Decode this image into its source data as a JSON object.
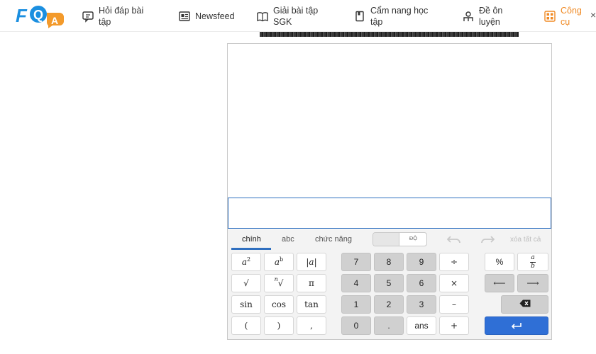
{
  "header": {
    "logo": {
      "letters": "FQA",
      "colors": {
        "blue": "#1b8fe0",
        "orange": "#f39a2b"
      }
    },
    "nav": [
      {
        "label_line1": "Hỏi đáp bài",
        "label_line2": "tập",
        "icon": "chat-question-icon"
      },
      {
        "label_line1": "Newsfeed",
        "label_line2": "",
        "icon": "newspaper-icon"
      },
      {
        "label_line1": "Giải bài tập",
        "label_line2": "SGK",
        "icon": "open-book-icon"
      },
      {
        "label_line1": "Cẩm nang học",
        "label_line2": "tập",
        "icon": "handbook-icon"
      },
      {
        "label_line1": "Đề ôn",
        "label_line2": "luyện",
        "icon": "student-icon"
      },
      {
        "label_line1": "Công",
        "label_line2": "cụ",
        "icon": "calculator-grid-icon",
        "active": true
      }
    ],
    "close_glyph": "×",
    "accent_color": "#f08a24"
  },
  "calculator": {
    "tabs": [
      {
        "label": "chính",
        "selected": true
      },
      {
        "label": "abc",
        "selected": false
      },
      {
        "label": "chức năng",
        "selected": false
      }
    ],
    "angle_toggle": {
      "right_label": "ĐỘ"
    },
    "clear_all": "xóa tất cả",
    "keys": {
      "a_squared": {
        "base": "a",
        "exp": "2"
      },
      "a_pow_b": {
        "base": "a",
        "exp": "b"
      },
      "abs": "|a|",
      "sqrt": "√",
      "nth_root": {
        "index": "n",
        "radical": "√"
      },
      "pi": "π",
      "sin": "sin",
      "cos": "cos",
      "tan": "tan",
      "lparen": "(",
      "rparen": ")",
      "comma": ",",
      "n7": "7",
      "n8": "8",
      "n9": "9",
      "divide": "÷",
      "n4": "4",
      "n5": "5",
      "n6": "6",
      "multiply": "×",
      "n1": "1",
      "n2": "2",
      "n3": "3",
      "minus": "–",
      "n0": "0",
      "dot": ".",
      "ans": "ans",
      "plus": "+",
      "percent": "%",
      "fraction": {
        "num": "a",
        "den": "b"
      },
      "left_arrow": "⟵",
      "right_arrow": "⟶",
      "enter": "↵"
    },
    "colors": {
      "accent": "#2f6fd6",
      "keypad_bg": "#f3f3f3"
    }
  }
}
